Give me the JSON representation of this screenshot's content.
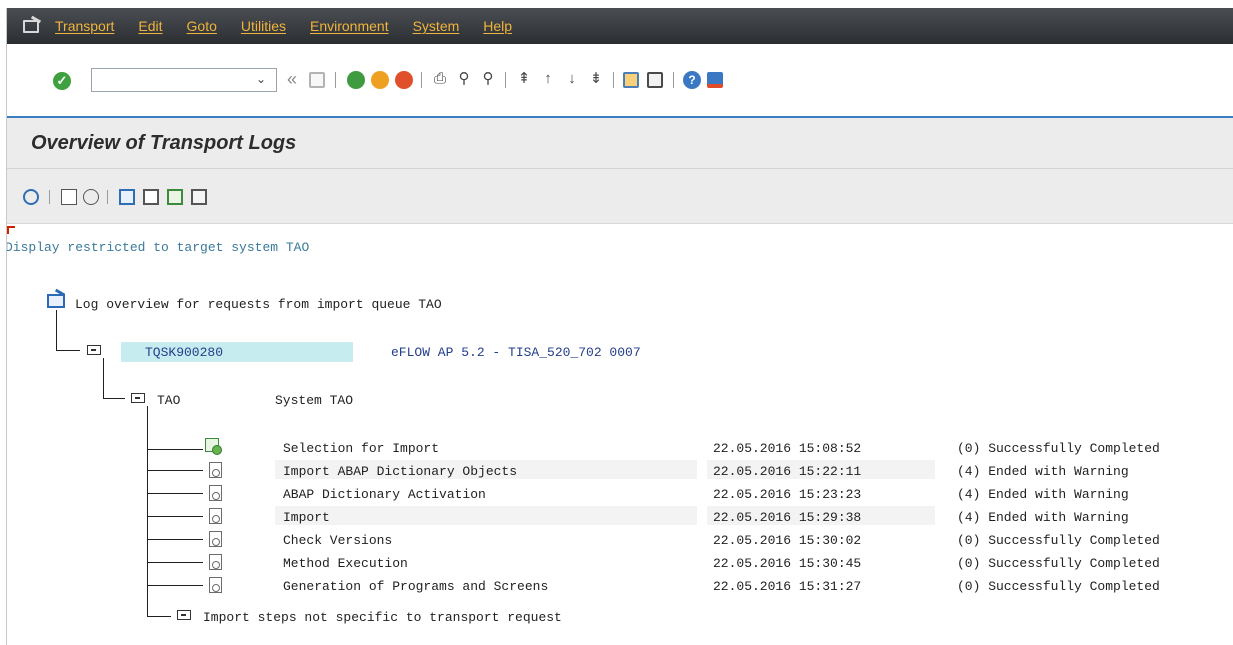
{
  "menu": {
    "items": [
      "Transport",
      "Edit",
      "Goto",
      "Utilities",
      "Environment",
      "System",
      "Help"
    ]
  },
  "toolbar": {
    "command_value": "",
    "icons": [
      "enter-icon",
      "command-dropdown-icon",
      "fast-back-icon",
      "save-icon",
      "back-icon",
      "exit-icon",
      "cancel-icon",
      "print-icon",
      "find-icon",
      "find-next-icon",
      "first-page-icon",
      "previous-page-icon",
      "next-page-icon",
      "last-page-icon",
      "create-session-icon",
      "generate-shortcut-icon",
      "help-icon",
      "customize-layout-icon"
    ]
  },
  "page": {
    "title": "Overview of Transport Logs"
  },
  "app_toolbar": {
    "icons": [
      "refresh-icon",
      "display-log-icon",
      "display-glasses-icon",
      "expand-icon",
      "collapse-icon",
      "expand-subtree-icon",
      "collapse-subtree-icon"
    ]
  },
  "content": {
    "restriction_text": "Display restricted to target system TAO",
    "root_label": "Log overview for requests from import queue TAO",
    "request": {
      "id": "TQSK900280",
      "description": "eFLOW AP 5.2 - TISA_520_702 0007"
    },
    "system": {
      "id": "TAO",
      "label": "System TAO"
    },
    "steps": [
      {
        "name": "Selection for Import",
        "datetime": "22.05.2016 15:08:52",
        "status": "(0) Successfully Completed"
      },
      {
        "name": "Import ABAP Dictionary Objects",
        "datetime": "22.05.2016 15:22:11",
        "status": "(4) Ended with Warning"
      },
      {
        "name": "ABAP Dictionary Activation",
        "datetime": "22.05.2016 15:23:23",
        "status": "(4) Ended with Warning"
      },
      {
        "name": "Import",
        "datetime": "22.05.2016 15:29:38",
        "status": "(4) Ended with Warning"
      },
      {
        "name": "Check Versions",
        "datetime": "22.05.2016 15:30:02",
        "status": "(0) Successfully Completed"
      },
      {
        "name": "Method Execution",
        "datetime": "22.05.2016 15:30:45",
        "status": "(0) Successfully Completed"
      },
      {
        "name": "Generation of Programs and Screens",
        "datetime": "22.05.2016 15:31:27",
        "status": "(0) Successfully Completed"
      }
    ],
    "non_specific_label": "Import steps not specific to transport request"
  },
  "colors": {
    "menu_text": "#f0b43c",
    "menu_bg": "#2b2e31",
    "restriction_text": "#3a7a9a",
    "request_highlight": "#c6ecef",
    "accent_line": "#3a7fc1"
  }
}
